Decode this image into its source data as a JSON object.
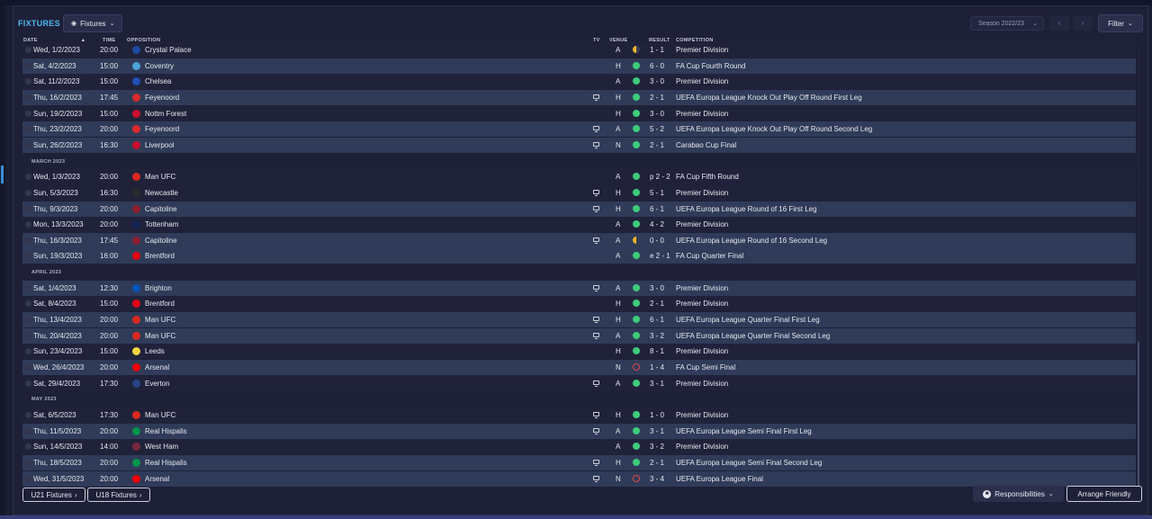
{
  "header": {
    "title": "FIXTURES",
    "view_dropdown": "Fixtures",
    "season": "Season 2022/23",
    "filter_label": "Filter"
  },
  "columns": {
    "date": "DATE",
    "time": "TIME",
    "opposition": "OPPOSITION",
    "tv": "TV",
    "venue": "VENUE",
    "result": "RESULT",
    "competition": "COMPETITION"
  },
  "colors": {
    "accent": "#4fb8f0",
    "win": "#3ecb7a",
    "loss": "#e04848",
    "draw": "#f0b429",
    "row_alt": "#2f3b58",
    "background": "#1b1d33"
  },
  "months": [
    "MARCH 2023",
    "APRIL 2023",
    "MAY 2023"
  ],
  "rows": [
    {
      "kind": "fixture",
      "date": "Wed, 1/2/2023",
      "time": "20:00",
      "opponent": "Crystal Palace",
      "badge": "#1b4aa0",
      "tv": false,
      "venue": "A",
      "outcome": "draw",
      "result": "1 - 1",
      "competition": "Premier Division",
      "alt": false
    },
    {
      "kind": "fixture",
      "date": "Sat, 4/2/2023",
      "time": "15:00",
      "opponent": "Coventry",
      "badge": "#4aa3d8",
      "tv": false,
      "venue": "H",
      "outcome": "win",
      "result": "6 - 0",
      "competition": "FA Cup Fourth Round",
      "alt": true
    },
    {
      "kind": "fixture",
      "date": "Sat, 11/2/2023",
      "time": "15:00",
      "opponent": "Chelsea",
      "badge": "#1f4fb5",
      "tv": false,
      "venue": "A",
      "outcome": "win",
      "result": "3 - 0",
      "competition": "Premier Division",
      "alt": false
    },
    {
      "kind": "fixture",
      "date": "Thu, 16/2/2023",
      "time": "17:45",
      "opponent": "Feyenoord",
      "badge": "#d82a2a",
      "tv": true,
      "venue": "H",
      "outcome": "win",
      "result": "2 - 1",
      "competition": "UEFA Europa League Knock Out Play Off Round First Leg",
      "alt": true
    },
    {
      "kind": "fixture",
      "date": "Sun, 19/2/2023",
      "time": "15:00",
      "opponent": "Nottm Forest",
      "badge": "#c8102e",
      "tv": false,
      "venue": "H",
      "outcome": "win",
      "result": "3 - 0",
      "competition": "Premier Division",
      "alt": false
    },
    {
      "kind": "fixture",
      "date": "Thu, 23/2/2023",
      "time": "20:00",
      "opponent": "Feyenoord",
      "badge": "#d82a2a",
      "tv": true,
      "venue": "A",
      "outcome": "win",
      "result": "5 - 2",
      "competition": "UEFA Europa League Knock Out Play Off Round Second Leg",
      "alt": true
    },
    {
      "kind": "fixture",
      "date": "Sun, 26/2/2023",
      "time": "16:30",
      "opponent": "Liverpool",
      "badge": "#c8102e",
      "tv": true,
      "venue": "N",
      "outcome": "win",
      "result": "2 - 1",
      "competition": "Carabao Cup Final",
      "alt": true
    },
    {
      "kind": "month",
      "label_index": 0
    },
    {
      "kind": "fixture",
      "date": "Wed, 1/3/2023",
      "time": "20:00",
      "opponent": "Man UFC",
      "badge": "#da291c",
      "tv": false,
      "venue": "A",
      "outcome": "win",
      "result": "p 2 - 2",
      "competition": "FA Cup Fifth Round",
      "alt": false
    },
    {
      "kind": "fixture",
      "date": "Sun, 5/3/2023",
      "time": "16:30",
      "opponent": "Newcastle",
      "badge": "#2b2b2b",
      "tv": true,
      "venue": "H",
      "outcome": "win",
      "result": "5 - 1",
      "competition": "Premier Division",
      "alt": false
    },
    {
      "kind": "fixture",
      "date": "Thu, 9/3/2023",
      "time": "20:00",
      "opponent": "Capitoline",
      "badge": "#8e1f2f",
      "tv": true,
      "venue": "H",
      "outcome": "win",
      "result": "6 - 1",
      "competition": "UEFA Europa League Round of 16  First Leg",
      "alt": true
    },
    {
      "kind": "fixture",
      "date": "Mon, 13/3/2023",
      "time": "20:00",
      "opponent": "Tottenham",
      "badge": "#132257",
      "tv": false,
      "venue": "A",
      "outcome": "win",
      "result": "4 - 2",
      "competition": "Premier Division",
      "alt": false
    },
    {
      "kind": "fixture",
      "date": "Thu, 16/3/2023",
      "time": "17:45",
      "opponent": "Capitoline",
      "badge": "#8e1f2f",
      "tv": true,
      "venue": "A",
      "outcome": "draw",
      "result": "0 - 0",
      "competition": "UEFA Europa League Round of 16  Second Leg",
      "alt": true
    },
    {
      "kind": "fixture",
      "date": "Sun, 19/3/2023",
      "time": "16:00",
      "opponent": "Brentford",
      "badge": "#e30613",
      "tv": false,
      "venue": "A",
      "outcome": "win",
      "result": "e 2 - 1",
      "competition": "FA Cup Quarter Final",
      "alt": true
    },
    {
      "kind": "month",
      "label_index": 1
    },
    {
      "kind": "fixture",
      "date": "Sat, 1/4/2023",
      "time": "12:30",
      "opponent": "Brighton",
      "badge": "#0057b8",
      "tv": true,
      "venue": "A",
      "outcome": "win",
      "result": "3 - 0",
      "competition": "Premier Division",
      "alt": true
    },
    {
      "kind": "fixture",
      "date": "Sat, 8/4/2023",
      "time": "15:00",
      "opponent": "Brentford",
      "badge": "#e30613",
      "tv": false,
      "venue": "H",
      "outcome": "win",
      "result": "2 - 1",
      "competition": "Premier Division",
      "alt": false
    },
    {
      "kind": "fixture",
      "date": "Thu, 13/4/2023",
      "time": "20:00",
      "opponent": "Man UFC",
      "badge": "#da291c",
      "tv": true,
      "venue": "H",
      "outcome": "win",
      "result": "6 - 1",
      "competition": "UEFA Europa League Quarter Final First Leg",
      "alt": true
    },
    {
      "kind": "fixture",
      "date": "Thu, 20/4/2023",
      "time": "20:00",
      "opponent": "Man UFC",
      "badge": "#da291c",
      "tv": true,
      "venue": "A",
      "outcome": "win",
      "result": "3 - 2",
      "competition": "UEFA Europa League Quarter Final Second Leg",
      "alt": true
    },
    {
      "kind": "fixture",
      "date": "Sun, 23/4/2023",
      "time": "15:00",
      "opponent": "Leeds",
      "badge": "#f2d43f",
      "tv": false,
      "venue": "H",
      "outcome": "win",
      "result": "8 - 1",
      "competition": "Premier Division",
      "alt": false
    },
    {
      "kind": "fixture",
      "date": "Wed, 26/4/2023",
      "time": "20:00",
      "opponent": "Arsenal",
      "badge": "#ef0107",
      "tv": false,
      "venue": "N",
      "outcome": "loss",
      "result": "1 - 4",
      "competition": "FA Cup Semi Final",
      "alt": true
    },
    {
      "kind": "fixture",
      "date": "Sat, 29/4/2023",
      "time": "17:30",
      "opponent": "Everton",
      "badge": "#274488",
      "tv": true,
      "venue": "A",
      "outcome": "win",
      "result": "3 - 1",
      "competition": "Premier Division",
      "alt": false
    },
    {
      "kind": "month",
      "label_index": 2
    },
    {
      "kind": "fixture",
      "date": "Sat, 6/5/2023",
      "time": "17:30",
      "opponent": "Man UFC",
      "badge": "#da291c",
      "tv": true,
      "venue": "H",
      "outcome": "win",
      "result": "1 - 0",
      "competition": "Premier Division",
      "alt": false
    },
    {
      "kind": "fixture",
      "date": "Thu, 11/5/2023",
      "time": "20:00",
      "opponent": "Real Hispalis",
      "badge": "#00954c",
      "tv": true,
      "venue": "A",
      "outcome": "win",
      "result": "3 - 1",
      "competition": "UEFA Europa League Semi Final First Leg",
      "alt": true
    },
    {
      "kind": "fixture",
      "date": "Sun, 14/5/2023",
      "time": "14:00",
      "opponent": "West Ham",
      "badge": "#7a263a",
      "tv": false,
      "venue": "A",
      "outcome": "win",
      "result": "3 - 2",
      "competition": "Premier Division",
      "alt": false
    },
    {
      "kind": "fixture",
      "date": "Thu, 18/5/2023",
      "time": "20:00",
      "opponent": "Real Hispalis",
      "badge": "#00954c",
      "tv": true,
      "venue": "H",
      "outcome": "win",
      "result": "2 - 1",
      "competition": "UEFA Europa League Semi Final Second Leg",
      "alt": true
    },
    {
      "kind": "fixture",
      "date": "Wed, 31/5/2023",
      "time": "20:00",
      "opponent": "Arsenal",
      "badge": "#ef0107",
      "tv": true,
      "venue": "N",
      "outcome": "loss",
      "result": "3 - 4",
      "competition": "UEFA Europa League Final",
      "alt": true
    }
  ],
  "footer": {
    "u21": "U21 Fixtures",
    "u18": "U18 Fixtures",
    "responsibilities": "Responsibilities",
    "arrange_friendly": "Arrange Friendly"
  }
}
